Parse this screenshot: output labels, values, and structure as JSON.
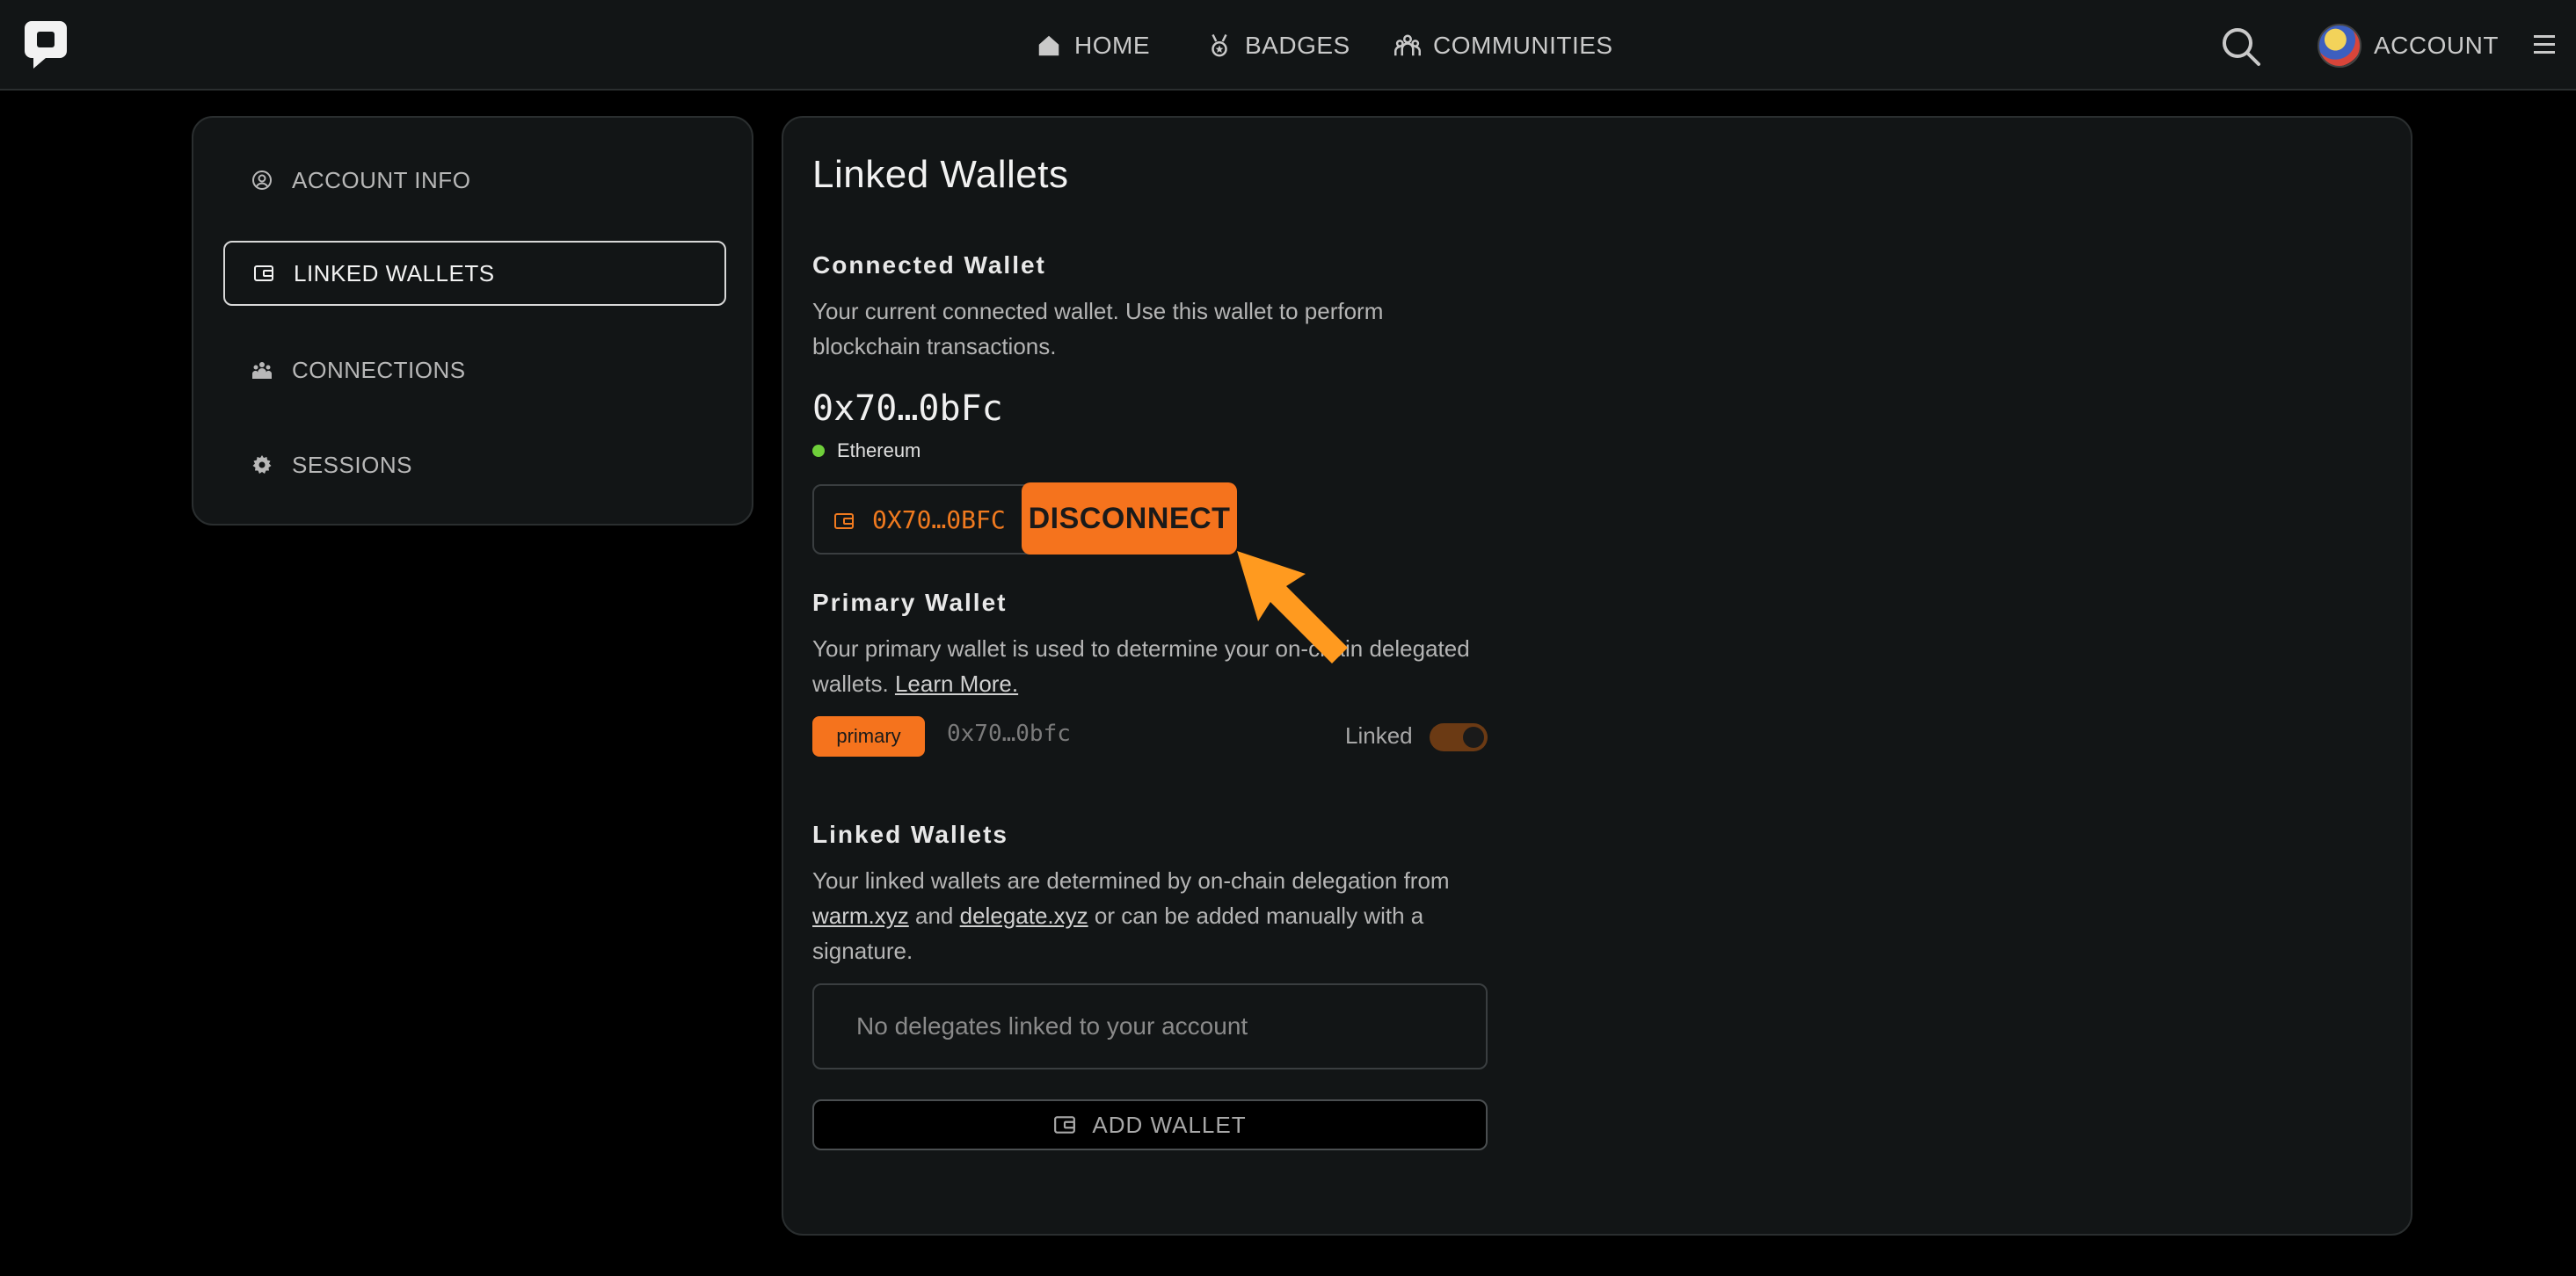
{
  "nav": {
    "home": "HOME",
    "badges": "BADGES",
    "communities": "COMMUNITIES",
    "account": "ACCOUNT"
  },
  "sidebar": {
    "items": [
      {
        "label": "ACCOUNT INFO",
        "icon": "user-circle-icon",
        "active": false
      },
      {
        "label": "LINKED WALLETS",
        "icon": "wallet-icon",
        "active": true
      },
      {
        "label": "CONNECTIONS",
        "icon": "people-icon",
        "active": false
      },
      {
        "label": "SESSIONS",
        "icon": "gear-icon",
        "active": false
      }
    ]
  },
  "main": {
    "title": "Linked Wallets",
    "connected": {
      "heading": "Connected Wallet",
      "description": "Your current connected wallet. Use this wallet to perform blockchain transactions.",
      "address": "0x70…0bFc",
      "chain": "Ethereum",
      "pill_address": "0X70…0BFC",
      "disconnect_label": "DISCONNECT"
    },
    "primary": {
      "heading": "Primary Wallet",
      "description": "Your primary wallet is used to determine your on-chain delegated wallets.",
      "learn_more": "Learn More.",
      "badge": "primary",
      "address": "0x70…0bfc",
      "linked_label": "Linked",
      "linked_toggle": true
    },
    "linked": {
      "heading": "Linked Wallets",
      "desc_start": "Your linked wallets are determined by on-chain delegation from",
      "link1": "warm.xyz",
      "and": "and",
      "link2": "delegate.xyz",
      "desc_end": "or can be added manually with a signature.",
      "empty": "No delegates linked to your account",
      "add_label": "ADD WALLET"
    }
  },
  "colors": {
    "accent": "#f5731d",
    "background": "#000000",
    "panel": "#121516",
    "chain_dot": "#6fcf3a"
  }
}
